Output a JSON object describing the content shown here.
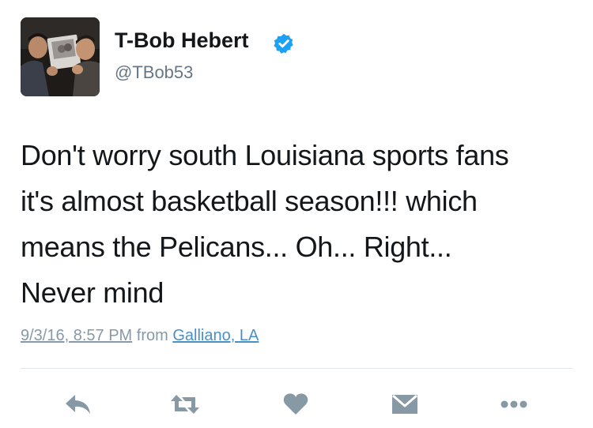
{
  "author": {
    "display_name": "T-Bob Hebert",
    "handle": "@TBob53",
    "verified": true,
    "avatar_icon": "profile-photo"
  },
  "tweet": {
    "text_lines": [
      "Don't worry south Louisiana sports fans",
      "it's almost basketball season!!! which",
      "means the Pelicans... Oh... Right...",
      "Never mind"
    ],
    "timestamp": "9/3/16, 8:57 PM",
    "from_label": "from",
    "location": "Galliano, LA"
  },
  "actions": [
    {
      "icon": "reply-icon"
    },
    {
      "icon": "retweet-icon"
    },
    {
      "icon": "like-heart-icon"
    },
    {
      "icon": "direct-message-icon"
    },
    {
      "icon": "more-options-icon"
    }
  ],
  "colors": {
    "text": "#14171a",
    "muted": "#8899a6",
    "link": "#4a90c8",
    "verified_badge": "#1da1f2",
    "action_icon": "#8899a6"
  }
}
